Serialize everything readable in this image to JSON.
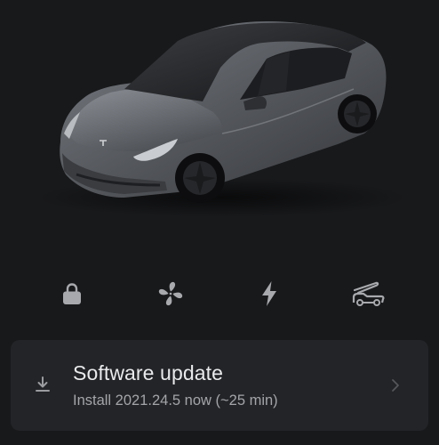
{
  "vehicle": {
    "image": "car-image",
    "color": "#5b5e63"
  },
  "quick_actions": [
    {
      "name": "lock",
      "icon": "lock-icon"
    },
    {
      "name": "climate",
      "icon": "fan-icon"
    },
    {
      "name": "charge",
      "icon": "bolt-icon"
    },
    {
      "name": "frunk",
      "icon": "frunk-icon"
    }
  ],
  "software_update": {
    "title": "Software update",
    "subtitle": "Install 2021.24.5 now (~25 min)",
    "icon": "download-icon",
    "chevron": "chevron-right-icon"
  },
  "colors": {
    "background": "#18191b",
    "card": "#232427",
    "icon": "#a7a9ad",
    "title": "#e9eaec",
    "subtitle": "#a3a5a9"
  }
}
